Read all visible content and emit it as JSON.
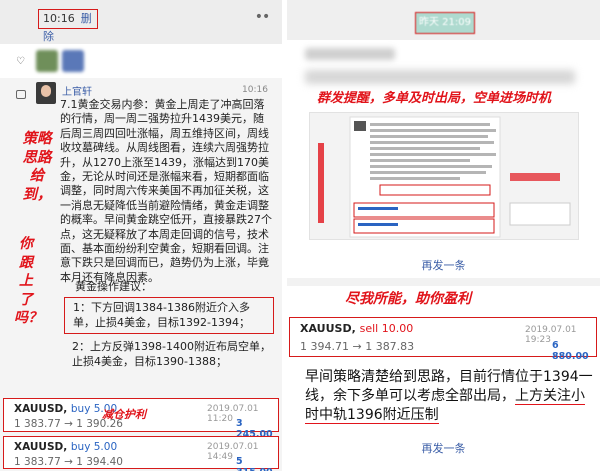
{
  "left": {
    "header": {
      "time": "10:16",
      "delete_label": "删除",
      "more": "••"
    },
    "author": "上官轩",
    "post_time": "10:16",
    "body": "7.1黄金交易内参：黄金上周走了冲高回落的行情，周一周二强势拉升1439美元，随后周三周四回吐涨幅，周五维持区间，周线收坟墓碑线。从周线图看，连续六周强势拉升，从1270上涨至1439，涨幅达到170美金，无论从时间还是涨幅来看，短期都面临调整，同时周六传来美国不再加征关税，这一消息无疑降低当前避险情绪，黄金走调整的概率。早间黄金跳空低开，直接暴跌27个点，这无疑释放了本周走回调的信号，技术面、基本面纷纷利空黄金，短期看回调。注意下跌只是回调而已，趋势仍为上涨，毕竟本月还有降息因素。",
    "ops_title": "黄金操作建议：",
    "suggestion1": "1：下方回调1384-1386附近介入多单，止损4美金，目标1392-1394；",
    "suggestion2": "2：上方反弹1398-1400附近布局空单，止损4美金，目标1390-1388；",
    "caption_vertical": "策略思路给到，",
    "caption_vertical2": "你跟上了吗？",
    "caption_trade": "减仓护利",
    "trades": [
      {
        "symbol": "XAUUSD,",
        "side": "buy 5.00",
        "prices": "1 383.77 → 1 390.26",
        "date": "2019.07.01 11:20",
        "profit": "3 245.00"
      },
      {
        "symbol": "XAUUSD,",
        "side": "buy 5.00",
        "prices": "1 383.77 → 1 394.40",
        "date": "2019.07.01 14:49",
        "profit": "5 315.00"
      }
    ]
  },
  "right": {
    "header_title": "昨天 21:09",
    "caption1": "群发提醒，多单及时出局，空单进场时机",
    "reply_label": "再发一条",
    "caption2": "尽我所能，助你盈利",
    "trade": {
      "symbol": "XAUUSD,",
      "side": "sell 10.00",
      "prices": "1 394.71 → 1 387.83",
      "date": "2019.07.01 19:23",
      "profit": "6 880.00"
    },
    "message_part1": "早间策略清楚给到思路，目前行情位于1394一线，余下多单可以考虑全部出局，",
    "message_part2": "上方关注小时中轨1396附近压制"
  },
  "colors": {
    "accent_red": "#e1141b",
    "link_blue": "#3b5ea7",
    "buy_blue": "#2a64c2"
  }
}
